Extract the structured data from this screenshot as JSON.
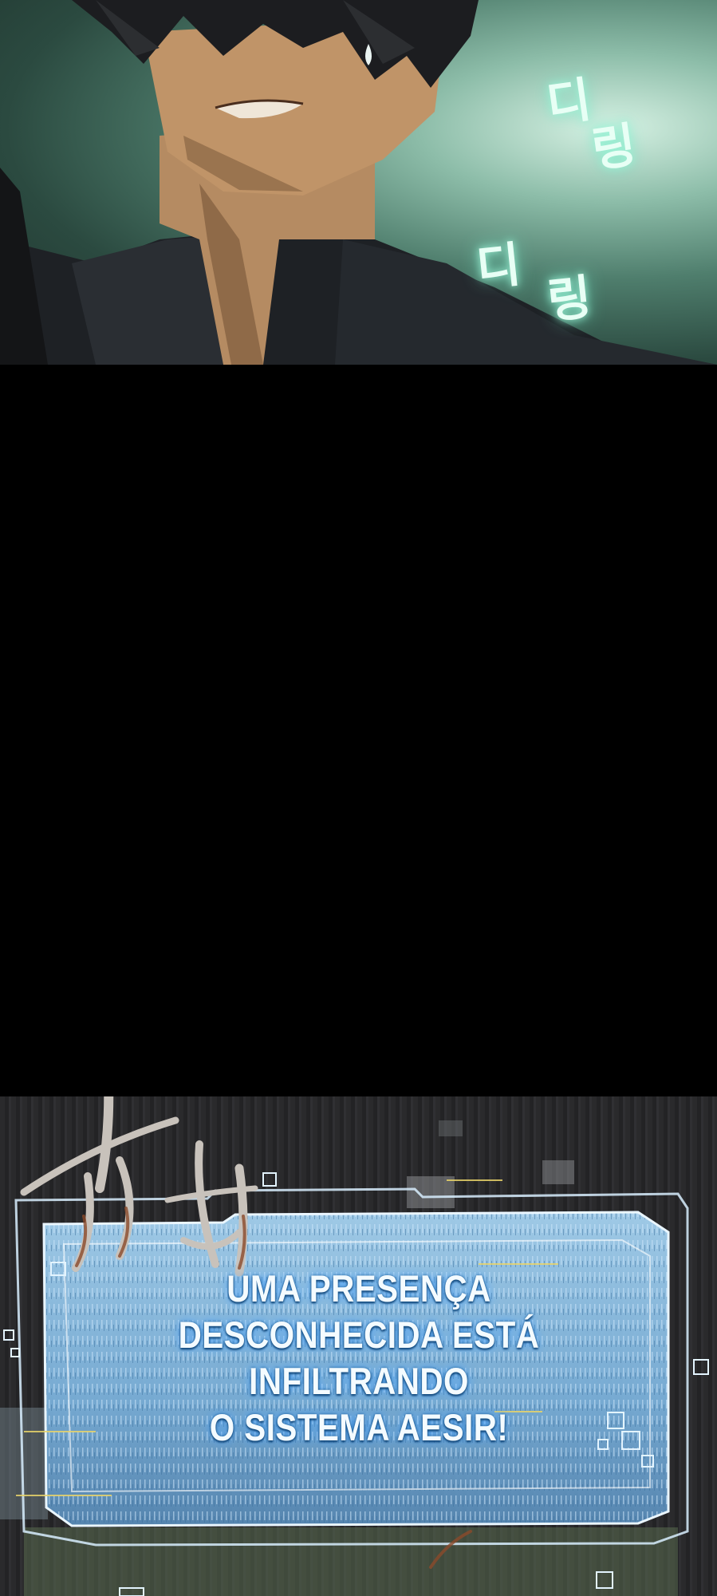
{
  "top_panel": {
    "sfx_upper": [
      "디",
      "링"
    ],
    "sfx_lower": [
      "디",
      "링"
    ]
  },
  "bottom_panel": {
    "sfx_scratch": "치칙",
    "system_message": {
      "line1": "UMA PRESENÇA",
      "line2": "DESCONHECIDA ESTÁ INFILTRANDO",
      "line3": "O SISTEMA AESIR!"
    }
  },
  "colors": {
    "glow_green": "#9ff5d8",
    "window_blue": "#8fc8f2",
    "window_border": "#cfe9ff",
    "gap": "#000000"
  }
}
